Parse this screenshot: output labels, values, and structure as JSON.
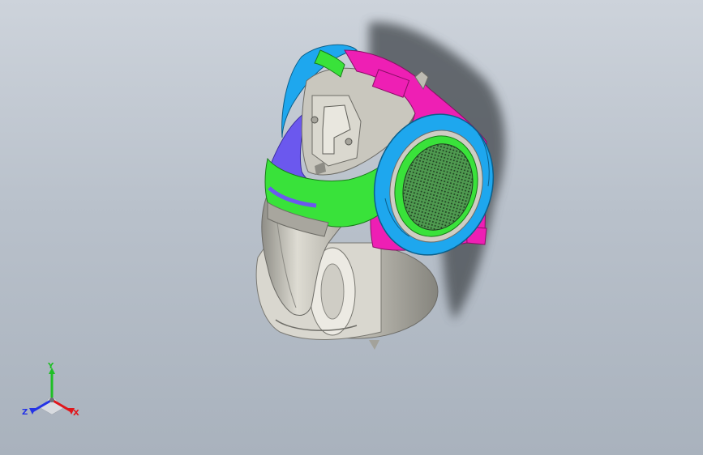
{
  "graphics_area": {
    "background": [
      "#cdd3db",
      "#a9b2bd"
    ]
  },
  "model": {
    "colors": {
      "body": "#c6c4bb",
      "body_shadow": "#8f8e87",
      "green": "#39e23a",
      "magenta": "#ee1fb4",
      "blue": "#1ea7ee",
      "purple": "#6b58ee",
      "mesh": "#5aa65b",
      "shadow": "#51565c"
    }
  },
  "triad": {
    "labels": {
      "x": "X",
      "y": "Y",
      "z": "Z"
    },
    "colors": {
      "x": "#e0161b",
      "y": "#1fbf25",
      "z": "#2433e6"
    }
  }
}
